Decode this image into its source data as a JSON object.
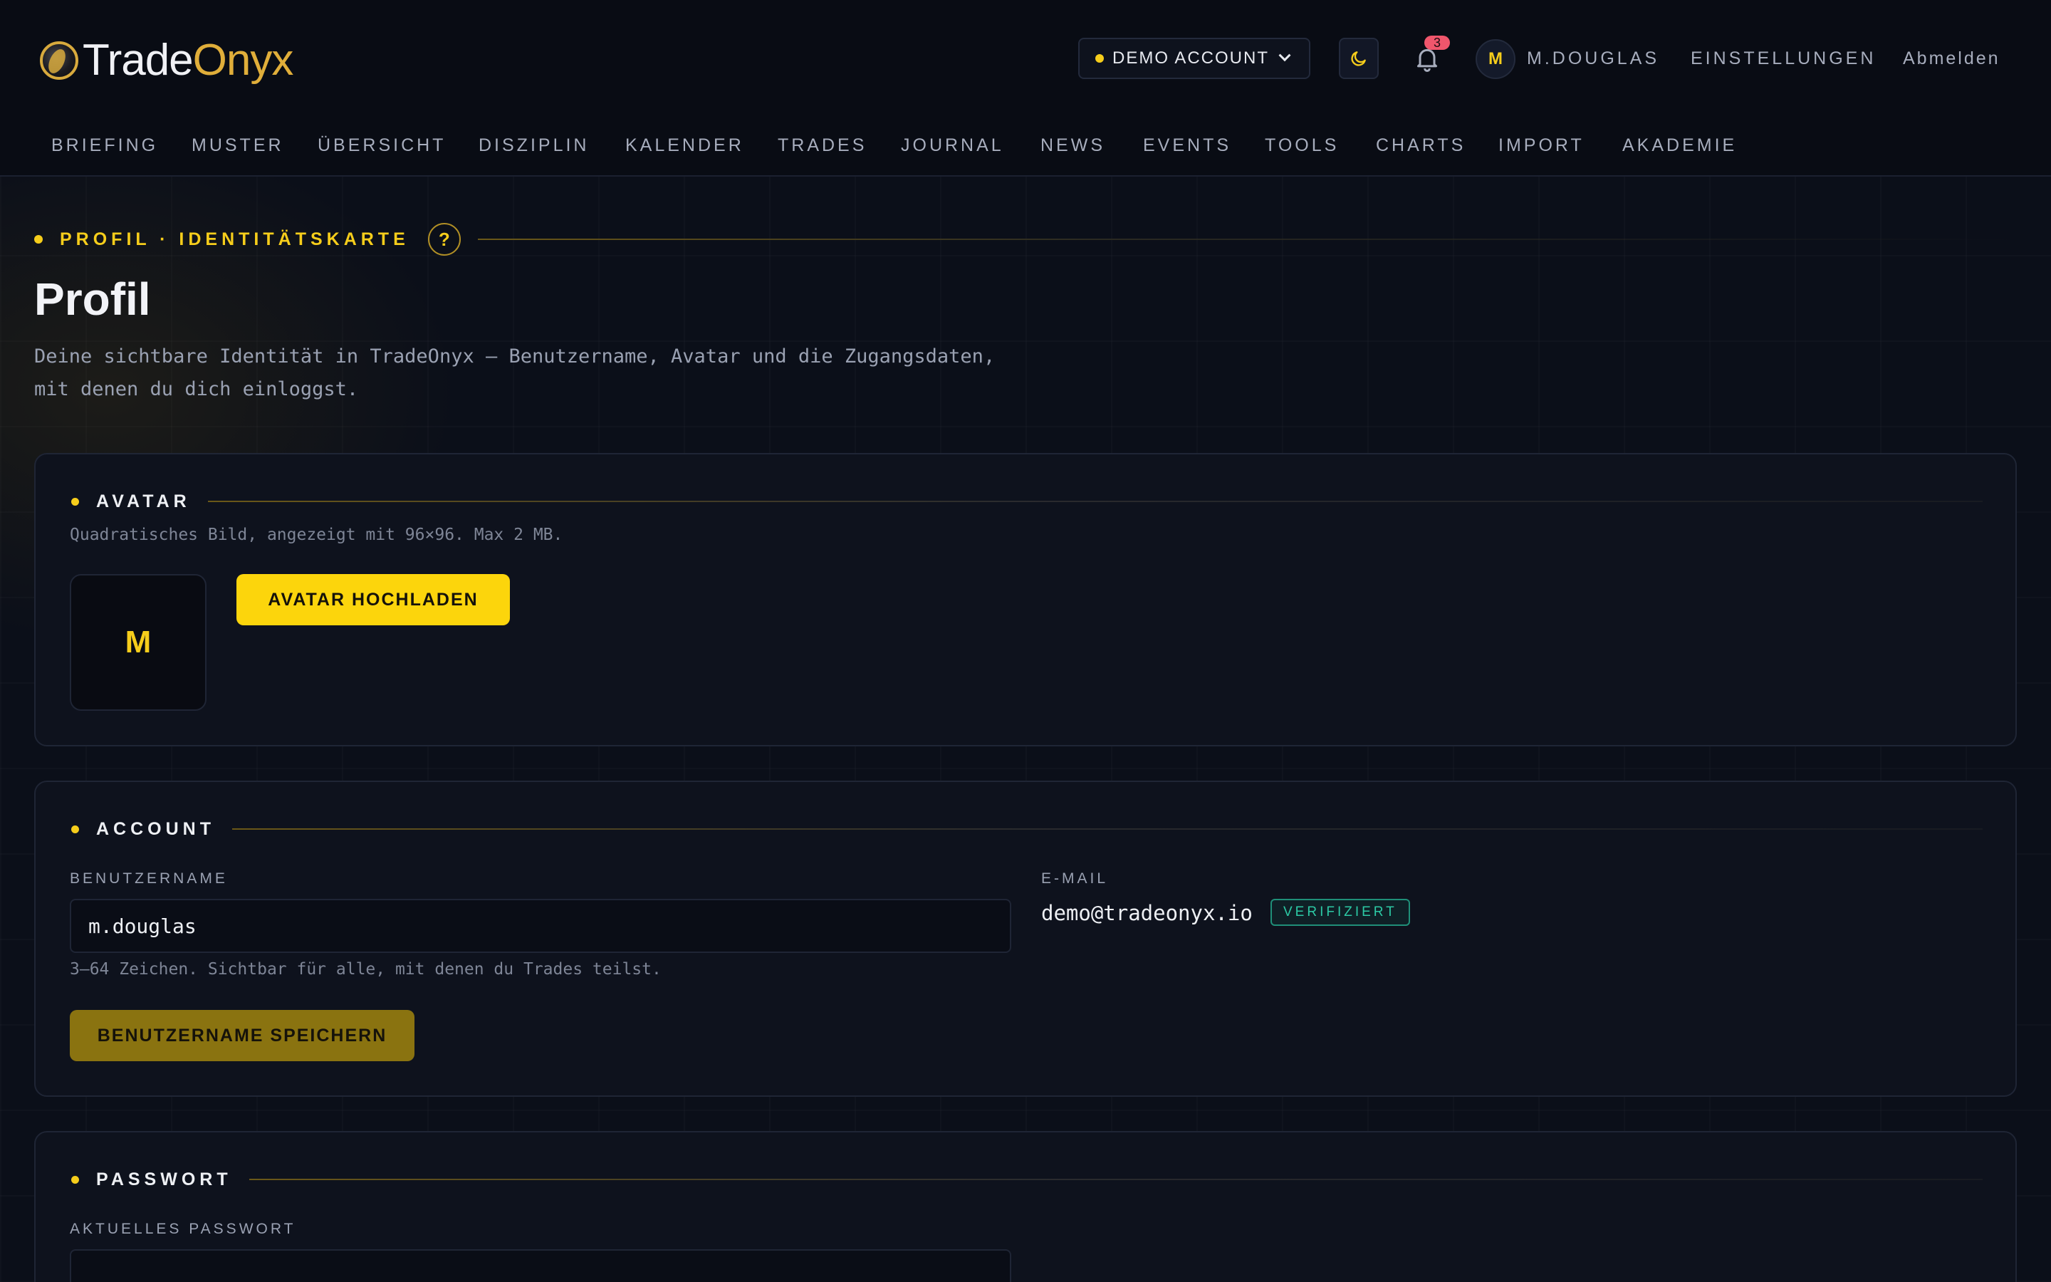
{
  "brand": {
    "name_part1": "Trade",
    "name_part2": "Onyx"
  },
  "header": {
    "account_label": "DEMO ACCOUNT",
    "notification_count": "3",
    "user_initial": "M",
    "username": "M.DOUGLAS",
    "settings_label": "EINSTELLUNGEN",
    "logout_label": "Abmelden"
  },
  "nav": {
    "tabs": [
      "BRIEFING",
      "MUSTER",
      "ÜBERSICHT",
      "DISZIPLIN",
      "KALENDER",
      "TRADES",
      "JOURNAL",
      "NEWS",
      "EVENTS",
      "TOOLS",
      "CHARTS",
      "IMPORT",
      "AKADEMIE"
    ]
  },
  "page": {
    "eyebrow": "PROFIL · IDENTITÄTSKARTE",
    "help_glyph": "?",
    "title": "Profil",
    "subtitle": "Deine sichtbare Identität in TradeOnyx — Benutzername, Avatar und die Zugangsdaten, mit denen du dich einloggst."
  },
  "avatar_card": {
    "title": "AVATAR",
    "hint": "Quadratisches Bild, angezeigt mit 96×96. Max 2 MB.",
    "initial": "M",
    "upload_label": "AVATAR HOCHLADEN"
  },
  "account_card": {
    "title": "ACCOUNT",
    "username_label": "BENUTZERNAME",
    "username_value": "m.douglas",
    "username_hint": "3–64 Zeichen. Sichtbar für alle, mit denen du Trades teilst.",
    "save_label": "BENUTZERNAME SPEICHERN",
    "email_label": "E-MAIL",
    "email_value": "demo@tradeonyx.io",
    "verified_label": "VERIFIZIERT"
  },
  "password_card": {
    "title": "PASSWORT",
    "current_label": "AKTUELLES PASSWORT"
  },
  "colors": {
    "accent": "#fcd50c",
    "background": "#0a0d16",
    "verified": "#2ccaa5",
    "badge": "#f0566c"
  }
}
